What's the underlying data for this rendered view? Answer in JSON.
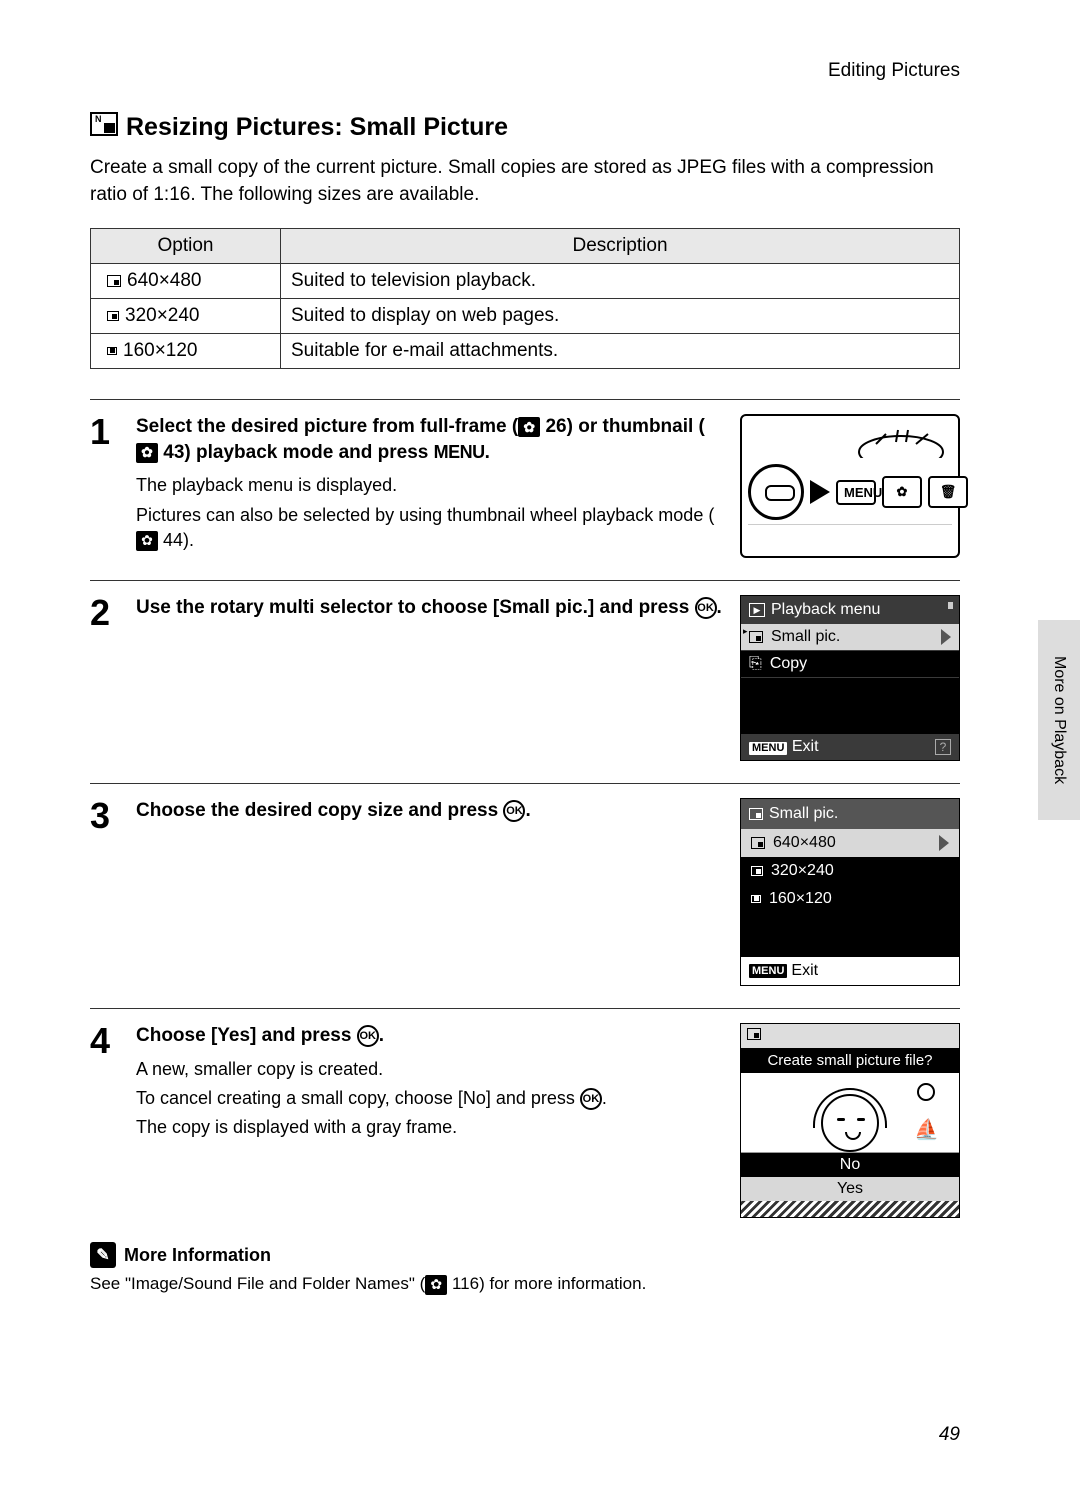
{
  "header": {
    "section": "Editing Pictures"
  },
  "title": "Resizing Pictures: Small Picture",
  "intro": "Create a small copy of the current picture. Small copies are stored as JPEG files with a compression ratio of 1:16. The following sizes are available.",
  "table": {
    "headers": [
      "Option",
      "Description"
    ],
    "rows": [
      {
        "option": "640×480",
        "desc": "Suited to television playback."
      },
      {
        "option": "320×240",
        "desc": "Suited to display on web pages."
      },
      {
        "option": "160×120",
        "desc": "Suitable for e-mail attachments."
      }
    ]
  },
  "steps": {
    "s1": {
      "num": "1",
      "title_a": "Select the desired picture from full-frame (",
      "ref1": "26",
      "title_b": ") or thumbnail (",
      "ref2": "43",
      "title_c": ") playback mode and press ",
      "menu": "MENU",
      "title_d": ".",
      "desc1": "The playback menu is displayed.",
      "desc2a": "Pictures can also be selected by using thumbnail wheel playback mode (",
      "desc2ref": "44",
      "desc2b": ").",
      "cam_menu": "MENU"
    },
    "s2": {
      "num": "2",
      "title_a": "Use the rotary multi selector to choose [Small pic.] and press ",
      "ok": "OK",
      "title_b": ".",
      "screen": {
        "header": "Playback menu",
        "row1": "Small pic.",
        "row2": "Copy",
        "footer_menu": "MENU",
        "footer_exit": "Exit"
      }
    },
    "s3": {
      "num": "3",
      "title_a": "Choose the desired copy size and press ",
      "ok": "OK",
      "title_b": ".",
      "screen": {
        "header": "Small pic.",
        "opt1": "640×480",
        "opt2": "320×240",
        "opt3": "160×120",
        "footer_menu": "MENU",
        "footer_exit": "Exit"
      }
    },
    "s4": {
      "num": "4",
      "title_a": "Choose [Yes] and press ",
      "ok": "OK",
      "title_b": ".",
      "desc1": "A new, smaller copy is created.",
      "desc2a": "To cancel creating a small copy, choose [No] and press ",
      "desc2ok": "OK",
      "desc2b": ".",
      "desc3": "The copy is displayed with a gray frame.",
      "screen": {
        "question": "Create small picture file?",
        "no": "No",
        "yes": "Yes"
      }
    }
  },
  "more": {
    "title": "More Information",
    "desc_a": "See \"Image/Sound File and Folder Names\" (",
    "desc_ref": "116",
    "desc_b": ") for more information."
  },
  "sidetab": "More on Playback",
  "page_num": "49"
}
